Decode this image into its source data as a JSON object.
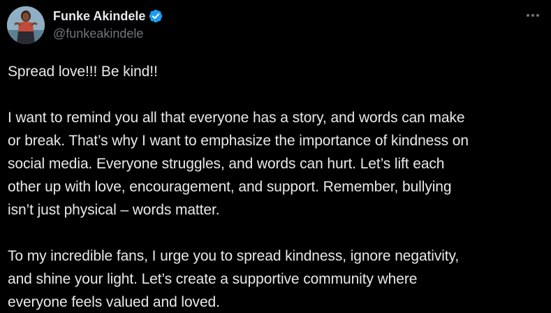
{
  "author": {
    "display_name": "Funke Akindele",
    "handle": "@funkeakindele",
    "verified_icon": "verified-badge-icon",
    "avatar": "profile-avatar"
  },
  "menu": {
    "more_icon": "more-options-icon"
  },
  "tweet": {
    "line1": "Spread love!!! Be kind!!",
    "para2": [
      "I want to remind you all that everyone has a story, and words can make",
      "or break. That’s why I want to emphasize the importance of kindness on",
      "social media. Everyone struggles, and words can hurt. Let’s lift each",
      "other up with love, encouragement, and support. Remember, bullying",
      "isn’t just physical – words matter."
    ],
    "para3": [
      "To my incredible fans, I urge you to spread kindness, ignore negativity,",
      "and shine your light. Let’s create a supportive community where",
      "everyone feels valued and loved."
    ]
  },
  "colors": {
    "background": "#000000",
    "text": "#e7e9ea",
    "muted": "#71767b",
    "verified": "#1d9bf0"
  }
}
